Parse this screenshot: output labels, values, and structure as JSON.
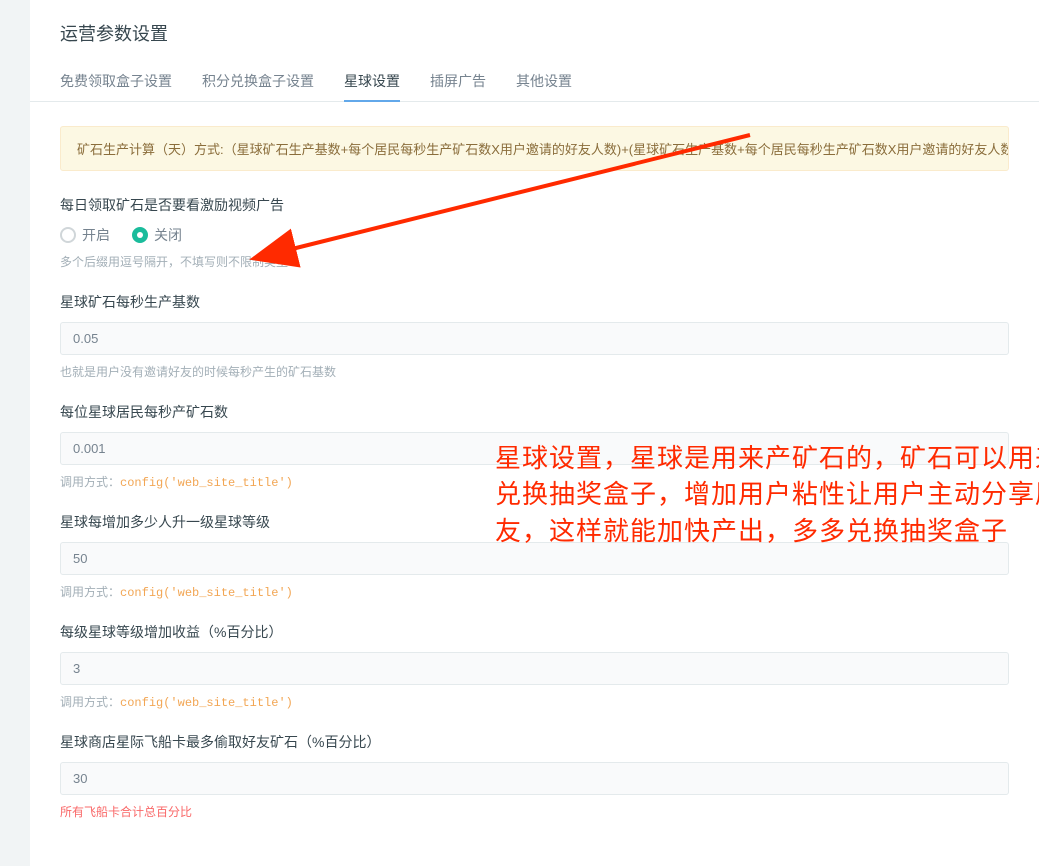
{
  "pageTitle": "运营参数设置",
  "tabs": [
    {
      "label": "免费领取盒子设置"
    },
    {
      "label": "积分兑换盒子设置"
    },
    {
      "label": "星球设置"
    },
    {
      "label": "插屏广告"
    },
    {
      "label": "其他设置"
    }
  ],
  "alert": "矿石生产计算（天）方式:（星球矿石生产基数+每个居民每秒生产矿石数X用户邀请的好友人数)+(星球矿石生产基数+每个居民每秒生产矿石数X用户邀请的好友人数)X星球等级",
  "videoAd": {
    "label": "每日领取矿石是否要看激励视频广告",
    "options": {
      "on": "开启",
      "off": "关闭"
    },
    "help": "多个后缀用逗号隔开，不填写则不限制类型"
  },
  "oreBase": {
    "label": "星球矿石每秒生产基数",
    "value": "0.05",
    "help": "也就是用户没有邀请好友的时候每秒产生的矿石基数"
  },
  "residentOre": {
    "label": "每位星球居民每秒产矿石数",
    "value": "0.001",
    "helpPrefix": "调用方式：",
    "helpCode": "config('web_site_title')"
  },
  "planetLevel": {
    "label": "星球每增加多少人升一级星球等级",
    "value": "50",
    "helpPrefix": "调用方式：",
    "helpCode": "config('web_site_title')"
  },
  "levelBonus": {
    "label": "每级星球等级增加收益（%百分比）",
    "value": "3",
    "helpPrefix": "调用方式：",
    "helpCode": "config('web_site_title')"
  },
  "stealMax": {
    "label": "星球商店星际飞船卡最多偷取好友矿石（%百分比）",
    "value": "30",
    "help": "所有飞船卡合计总百分比"
  },
  "annotation": "星球设置，星球是用来产矿石的，矿石可以用来兑换抽奖盒子，增加用户粘性让用户主动分享朋友，这样就能加快产出，多多兑换抽奖盒子"
}
